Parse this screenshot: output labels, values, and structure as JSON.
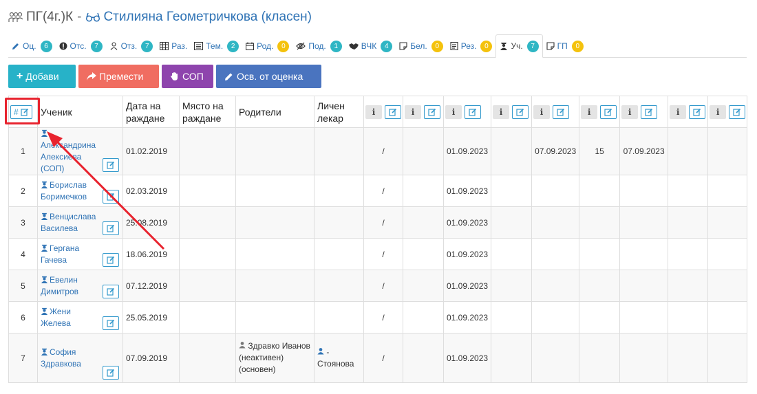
{
  "header": {
    "class_name": "ПГ(4г.)К",
    "separator": "-",
    "teacher_name": "Стилияна Геометричкова (класен)"
  },
  "tabs": [
    {
      "label": "Оц.",
      "icon": "pencil-icon",
      "badge": "6",
      "badge_color": "teal"
    },
    {
      "label": "Отс.",
      "icon": "exclamation-circle-icon",
      "badge": "7",
      "badge_color": "teal"
    },
    {
      "label": "Отз.",
      "icon": "users-icon",
      "badge": "7",
      "badge_color": "teal"
    },
    {
      "label": "Раз.",
      "icon": "table-icon",
      "badge": "",
      "badge_color": ""
    },
    {
      "label": "Тем.",
      "icon": "list-icon",
      "badge": "2",
      "badge_color": "teal"
    },
    {
      "label": "Род.",
      "icon": "calendar-icon",
      "badge": "0",
      "badge_color": "yellow"
    },
    {
      "label": "Под.",
      "icon": "eye-slash-icon",
      "badge": "1",
      "badge_color": "teal"
    },
    {
      "label": "ВЧК",
      "icon": "handshake-icon",
      "badge": "4",
      "badge_color": "teal"
    },
    {
      "label": "Бел.",
      "icon": "note-icon",
      "badge": "0",
      "badge_color": "yellow"
    },
    {
      "label": "Рез.",
      "icon": "document-icon",
      "badge": "0",
      "badge_color": "yellow"
    },
    {
      "label": "Уч.",
      "icon": "student-icon",
      "badge": "7",
      "badge_color": "teal",
      "active": true
    },
    {
      "label": "ГП",
      "icon": "note-icon",
      "badge": "0",
      "badge_color": "yellow"
    }
  ],
  "actions": {
    "add_label": "Добави",
    "move_label": "Премести",
    "sop_label": "СОП",
    "exempt_label": "Осв. от оценка"
  },
  "table": {
    "hash_label": "#",
    "columns": [
      "Ученик",
      "Дата на раждане",
      "Място на раждане",
      "Родители",
      "Личен лекар"
    ],
    "extra_column_count": 9,
    "rows": [
      {
        "num": "1",
        "name": "Александрина Алексиева (СОП)",
        "birth_date": "01.02.2019",
        "birth_place": "",
        "parents": "",
        "doctor": "",
        "c1": "/",
        "c2": "",
        "c3": "01.09.2023",
        "c4": "",
        "c5": "07.09.2023",
        "c6": "15",
        "c7": "07.09.2023",
        "c8": "",
        "c9": ""
      },
      {
        "num": "2",
        "name": "Борислав Боримечков",
        "birth_date": "02.03.2019",
        "birth_place": "",
        "parents": "",
        "doctor": "",
        "c1": "/",
        "c2": "",
        "c3": "01.09.2023",
        "c4": "",
        "c5": "",
        "c6": "",
        "c7": "",
        "c8": "",
        "c9": ""
      },
      {
        "num": "3",
        "name": "Венцислава Василева",
        "birth_date": "25.08.2019",
        "birth_place": "",
        "parents": "",
        "doctor": "",
        "c1": "/",
        "c2": "",
        "c3": "01.09.2023",
        "c4": "",
        "c5": "",
        "c6": "",
        "c7": "",
        "c8": "",
        "c9": ""
      },
      {
        "num": "4",
        "name": "Гергана Гачева",
        "birth_date": "18.06.2019",
        "birth_place": "",
        "parents": "",
        "doctor": "",
        "c1": "/",
        "c2": "",
        "c3": "01.09.2023",
        "c4": "",
        "c5": "",
        "c6": "",
        "c7": "",
        "c8": "",
        "c9": ""
      },
      {
        "num": "5",
        "name": "Евелин Димитров",
        "birth_date": "07.12.2019",
        "birth_place": "",
        "parents": "",
        "doctor": "",
        "c1": "/",
        "c2": "",
        "c3": "01.09.2023",
        "c4": "",
        "c5": "",
        "c6": "",
        "c7": "",
        "c8": "",
        "c9": ""
      },
      {
        "num": "6",
        "name": "Жени Желева",
        "birth_date": "25.05.2019",
        "birth_place": "",
        "parents": "",
        "doctor": "",
        "c1": "/",
        "c2": "",
        "c3": "01.09.2023",
        "c4": "",
        "c5": "",
        "c6": "",
        "c7": "",
        "c8": "",
        "c9": ""
      },
      {
        "num": "7",
        "name": "София Здравкова",
        "birth_date": "07.09.2019",
        "birth_place": "",
        "parents": "Здравко Иванов (неактивен) (основен)",
        "doctor": "- Стоянова",
        "c1": "/",
        "c2": "",
        "c3": "01.09.2023",
        "c4": "",
        "c5": "",
        "c6": "",
        "c7": "",
        "c8": "",
        "c9": ""
      }
    ]
  },
  "colors": {
    "teal": "#2fb6c4",
    "yellow": "#f4c20d",
    "link": "#2f73b5",
    "add": "#27b2c8",
    "move": "#f06d61",
    "sop": "#8e44ad",
    "exempt": "#4a74bf",
    "annotation": "#e8232e"
  }
}
